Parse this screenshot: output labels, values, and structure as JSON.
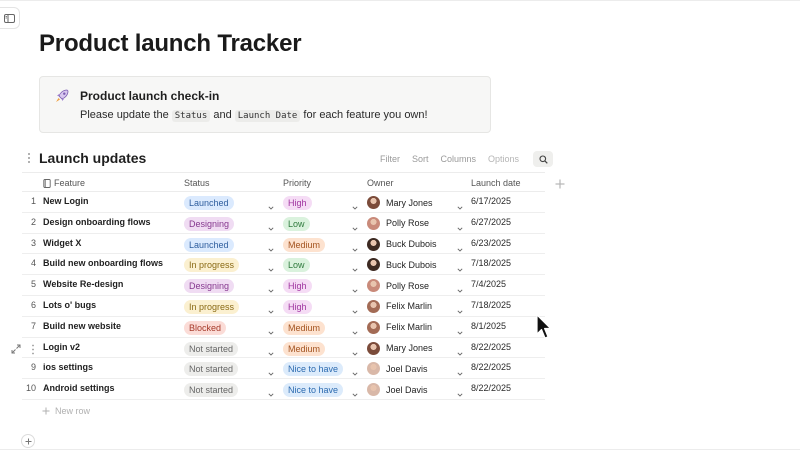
{
  "page": {
    "title": "Product launch Tracker"
  },
  "callout": {
    "title": "Product launch check-in",
    "text_before": "Please update the",
    "code_status": "Status",
    "text_and": "and",
    "code_date": "Launch Date",
    "text_after": "for each feature you own!"
  },
  "section": {
    "title": "Launch updates"
  },
  "toolbar": {
    "filter": "Filter",
    "sort": "Sort",
    "columns": "Columns",
    "options": "Options"
  },
  "table": {
    "headers": {
      "feature": "Feature",
      "status": "Status",
      "priority": "Priority",
      "owner": "Owner",
      "launch_date": "Launch date"
    },
    "new_row": "New row",
    "rows": [
      {
        "num": "1",
        "feature": "New Login",
        "status": "Launched",
        "priority": "High",
        "owner": "Mary Jones",
        "date": "6/17/2025"
      },
      {
        "num": "2",
        "feature": "Design onboarding flows",
        "status": "Designing",
        "priority": "Low",
        "owner": "Polly Rose",
        "date": "6/27/2025"
      },
      {
        "num": "3",
        "feature": "Widget X",
        "status": "Launched",
        "priority": "Medium",
        "owner": "Buck Dubois",
        "date": "6/23/2025"
      },
      {
        "num": "4",
        "feature": "Build new onboarding flows",
        "status": "In progress",
        "priority": "Low",
        "owner": "Buck Dubois",
        "date": "7/18/2025"
      },
      {
        "num": "5",
        "feature": "Website Re-design",
        "status": "Designing",
        "priority": "High",
        "owner": "Polly Rose",
        "date": "7/4/2025"
      },
      {
        "num": "6",
        "feature": "Lots o' bugs",
        "status": "In progress",
        "priority": "High",
        "owner": "Felix Marlin",
        "date": "7/18/2025"
      },
      {
        "num": "7",
        "feature": "Build new website",
        "status": "Blocked",
        "priority": "Medium",
        "owner": "Felix Marlin",
        "date": "8/1/2025"
      },
      {
        "num": "",
        "feature": "Login v2",
        "status": "Not started",
        "priority": "Medium",
        "owner": "Mary Jones",
        "date": "8/22/2025"
      },
      {
        "num": "9",
        "feature": "ios settings",
        "status": "Not started",
        "priority": "Nice to have",
        "owner": "Joel Davis",
        "date": "8/22/2025"
      },
      {
        "num": "10",
        "feature": "Android settings",
        "status": "Not started",
        "priority": "Nice to have",
        "owner": "Joel Davis",
        "date": "8/22/2025"
      }
    ]
  },
  "colors": {
    "status": {
      "Launched": {
        "bg": "#dbeafe",
        "fg": "#2f5e9e"
      },
      "Designing": {
        "bg": "#f0dcf3",
        "fg": "#86398f"
      },
      "In progress": {
        "bg": "#fbf0d0",
        "fg": "#8a6a15"
      },
      "Blocked": {
        "bg": "#fbdcd7",
        "fg": "#a63a2a"
      },
      "Not started": {
        "bg": "#ededeb",
        "fg": "#666666"
      }
    },
    "priority": {
      "High": {
        "bg": "#f5dcf5",
        "fg": "#a034a0"
      },
      "Low": {
        "bg": "#daf2dd",
        "fg": "#2f7a3d"
      },
      "Medium": {
        "bg": "#fde2cf",
        "fg": "#a3531f"
      },
      "Nice to have": {
        "bg": "#dcebfb",
        "fg": "#2c6bb0"
      }
    },
    "avatars": {
      "Mary Jones": "#7b4b3a",
      "Polly Rose": "#c98a7a",
      "Buck Dubois": "#3d2a22",
      "Felix Marlin": "#a36b55",
      "Joel Davis": "#d9b8a8"
    }
  },
  "icons": {
    "sidebar": "sidebar-toggle-icon",
    "callout": "rocket-icon",
    "feature_header": "bookmark-icon",
    "search": "search-icon",
    "add_column": "plus-icon",
    "expand": "expand-icon",
    "cursor": "mouse-pointer-icon"
  }
}
